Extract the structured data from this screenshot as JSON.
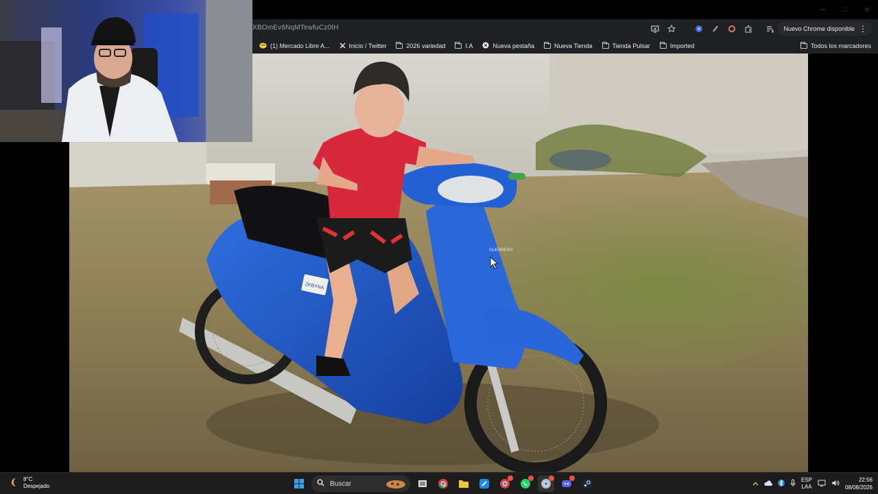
{
  "browser": {
    "url_fragment": "XBOmEv6NqMTewfuCz0tH",
    "update_button_label": "Nuevo Chrome disponible",
    "bookmarks": [
      {
        "label": "(1) Mercado Libre A...",
        "icon": "mercadolibre-icon"
      },
      {
        "label": "Inicio / Twitter",
        "icon": "x-icon"
      },
      {
        "label": "2026 variedad",
        "icon": "folder-icon"
      },
      {
        "label": "I.A",
        "icon": "folder-icon"
      },
      {
        "label": "Nueva pestaña",
        "icon": "globe-icon"
      },
      {
        "label": "Nueva Tienda",
        "icon": "folder-icon"
      },
      {
        "label": "Tienda Pulsar",
        "icon": "folder-icon"
      },
      {
        "label": "Imported",
        "icon": "folder-icon"
      }
    ],
    "all_bookmarks_label": "Todos los marcadores"
  },
  "photo": {
    "plate_text": "ZKBYNA",
    "brand_text": "GUERRERO"
  },
  "taskbar": {
    "weather_temp": "8°C",
    "weather_desc": "Despejado",
    "search_placeholder": "Buscar",
    "lang_top": "ESP",
    "lang_bottom": "LAA",
    "time": "22:56",
    "date": "08/08/2026"
  },
  "colors": {
    "browser_bg": "#202124",
    "taskbar_bg": "#1c1c1c",
    "moto_blue": "#1f55c6"
  }
}
